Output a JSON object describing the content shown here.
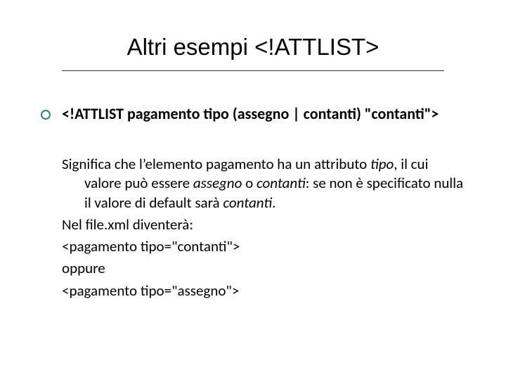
{
  "title": "Altri esempi <!ATTLIST>",
  "code": "<!ATTLIST pagamento tipo (assegno | contanti) \"contanti\">",
  "body": {
    "p1_a": "Significa che l’elemento pagamento ha un attributo ",
    "p1_tipo": "tipo",
    "p1_b": ", il cui valore può essere ",
    "p1_assegno": "assegno",
    "p1_c": " o ",
    "p1_contanti": "contanti",
    "p1_d": ": se non è specificato nulla il valore di default sarà ",
    "p1_contanti2": "contanti",
    "p1_e": ".",
    "p2": "Nel file.xml diventerà:",
    "p3": "<pagamento tipo=\"contanti\">",
    "p4": "oppure",
    "p5": "<pagamento tipo=\"assegno\">"
  }
}
